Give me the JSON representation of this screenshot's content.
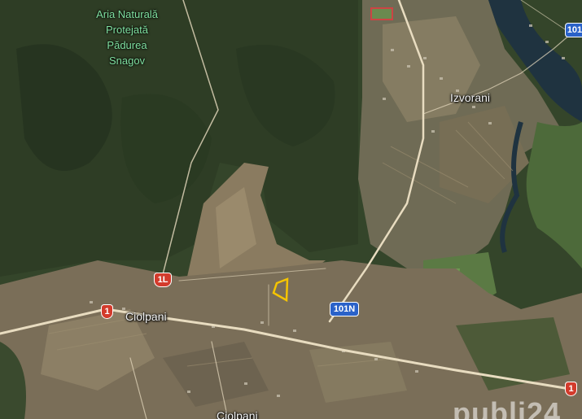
{
  "map": {
    "protected_area": {
      "lines": [
        "Aria Naturală",
        "Protejată",
        "Pădurea",
        "Snagov"
      ]
    },
    "places": {
      "izvorani": "Izvorani",
      "ciolpani": "Ciolpani",
      "ciolpani_south": "Ciolpani"
    },
    "road_shields": {
      "r1l": "1L",
      "r1_west": "1",
      "r1_east": "1",
      "r101n": "101N",
      "r101_ne": "101"
    },
    "watermark": "publi24",
    "colors": {
      "forest": "#34452a",
      "farmland": "#7a6e58",
      "parcel_outline": "#f5c400",
      "road": "#e8dcc0",
      "river": "#1f3340",
      "route_red": "#d33b2c",
      "route_blue": "#2a62c9"
    }
  }
}
